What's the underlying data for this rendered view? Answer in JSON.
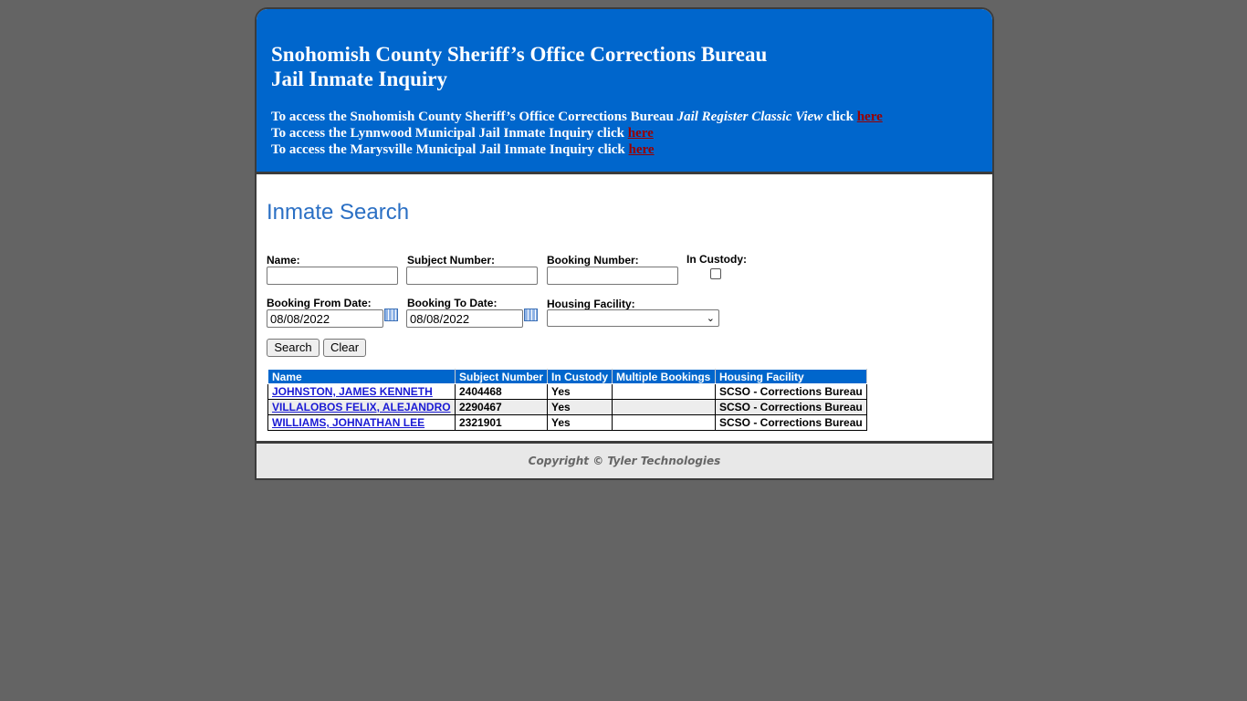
{
  "header": {
    "title_line1": "Snohomish County Sheriff’s Office Corrections Bureau",
    "title_line2": "Jail Inmate Inquiry",
    "links": [
      {
        "prefix": "To access the Snohomish County Sheriff’s Office Corrections Bureau ",
        "italic": "Jail Register Classic View",
        "suffix": " click ",
        "link_label": "here"
      },
      {
        "prefix": "To access the Lynnwood Municipal Jail Inmate Inquiry click ",
        "italic": "",
        "suffix": "",
        "link_label": "here"
      },
      {
        "prefix": "To access the Marysville Municipal Jail Inmate Inquiry click ",
        "italic": "",
        "suffix": "",
        "link_label": "here"
      }
    ]
  },
  "search": {
    "title": "Inmate Search",
    "name_label": "Name:",
    "subject_label": "Subject Number:",
    "booking_label": "Booking Number:",
    "custody_label": "In Custody:",
    "from_label": "Booking From Date:",
    "from_value": "08/08/2022",
    "to_label": "Booking To Date:",
    "to_value": "08/08/2022",
    "facility_label": "Housing Facility:",
    "search_button": "Search",
    "clear_button": "Clear"
  },
  "results": {
    "columns": [
      "Name",
      "Subject Number",
      "In Custody",
      "Multiple Bookings",
      "Housing Facility"
    ],
    "rows": [
      [
        "JOHNSTON, JAMES KENNETH",
        "2404468",
        "Yes",
        "",
        "SCSO - Corrections Bureau"
      ],
      [
        "VILLALOBOS FELIX, ALEJANDRO",
        "2290467",
        "Yes",
        "",
        "SCSO - Corrections Bureau"
      ],
      [
        "WILLIAMS, JOHNATHAN LEE",
        "2321901",
        "Yes",
        "",
        "SCSO - Corrections Bureau"
      ]
    ]
  },
  "footer": {
    "copyright": "Copyright © Tyler Technologies"
  },
  "colors": {
    "header_bg": "#0066cc",
    "page_bg": "#646464",
    "link_red": "#990000",
    "link_blue": "#1a1ad4"
  }
}
